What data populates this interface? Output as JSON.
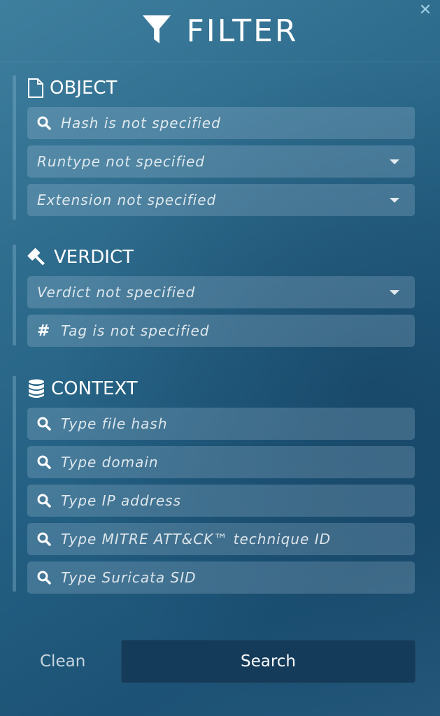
{
  "header": {
    "title": "FILTER",
    "close_icon": "close-icon"
  },
  "sections": {
    "object": {
      "title": "OBJECT",
      "icon": "file-icon",
      "hash": {
        "placeholder": "Hash is not specified",
        "icon": "search-icon"
      },
      "runtype": {
        "placeholder": "Runtype not specified"
      },
      "extension": {
        "placeholder": "Extension not specified"
      }
    },
    "verdict": {
      "title": "VERDICT",
      "icon": "gavel-icon",
      "verdict": {
        "placeholder": "Verdict not specified"
      },
      "tag": {
        "placeholder": "Tag is not specified",
        "icon": "hash-icon"
      }
    },
    "context": {
      "title": "CONTEXT",
      "icon": "database-icon",
      "file_hash": {
        "placeholder": "Type file hash"
      },
      "domain": {
        "placeholder": "Type domain"
      },
      "ip": {
        "placeholder": "Type IP address"
      },
      "mitre": {
        "placeholder": "Type MITRE ATT&CK™ technique ID"
      },
      "suricata": {
        "placeholder": "Type Suricata SID"
      }
    }
  },
  "footer": {
    "clean_label": "Clean",
    "search_label": "Search"
  },
  "colors": {
    "background_top": "#3f7f9e",
    "background_bottom": "#1c5275",
    "search_button": "#143b5a",
    "close": "#9fd0e6"
  }
}
